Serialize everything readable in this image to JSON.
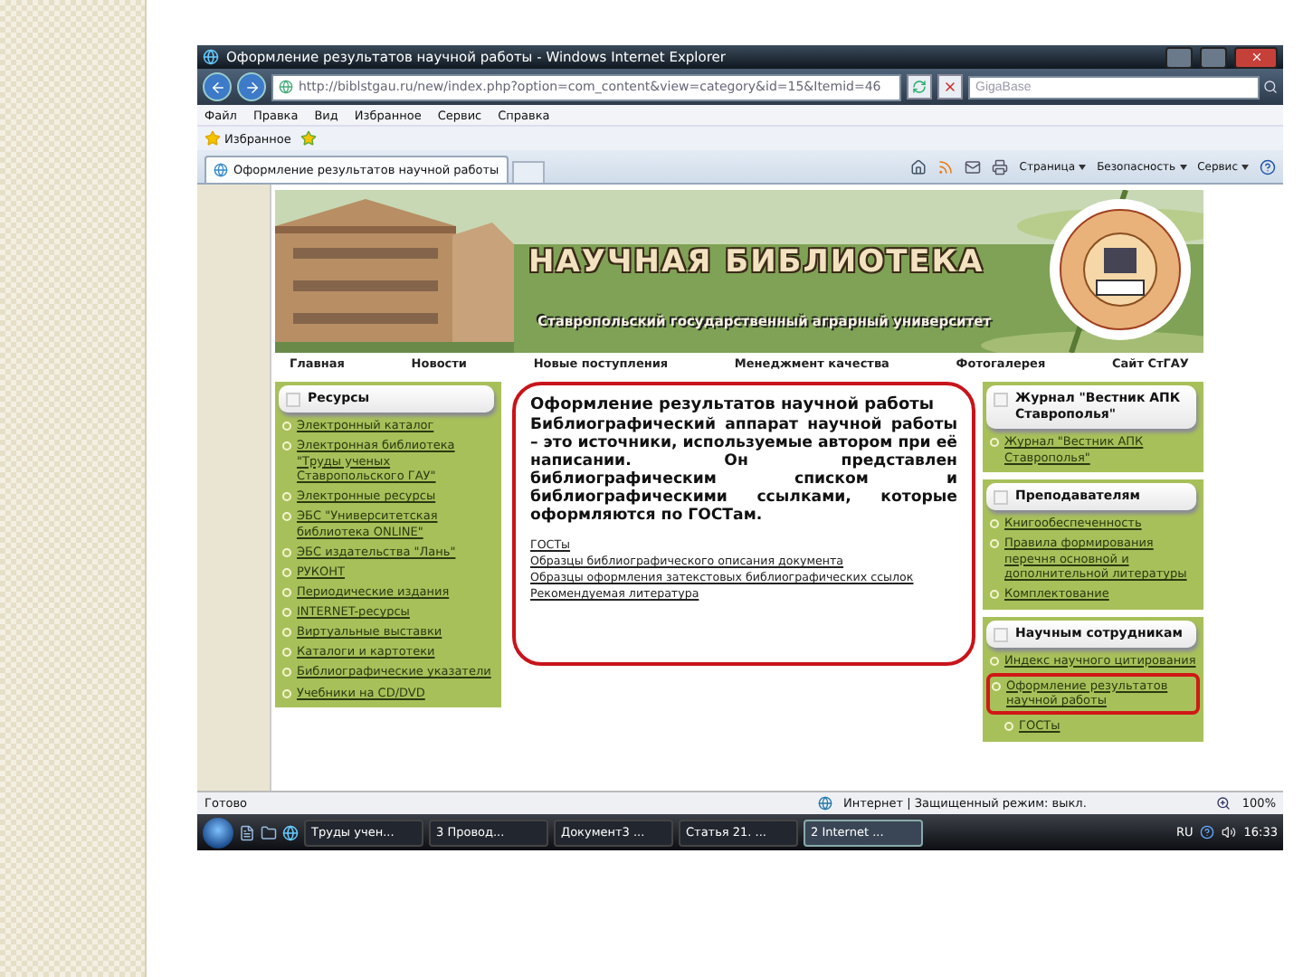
{
  "window": {
    "title": "Оформление результатов научной работы - Windows Internet Explorer"
  },
  "address_bar": {
    "url": "http://biblstgau.ru/new/index.php?option=com_content&view=category&id=15&Itemid=46"
  },
  "search": {
    "placeholder": "GigaBase"
  },
  "menu": [
    "Файл",
    "Правка",
    "Вид",
    "Избранное",
    "Сервис",
    "Справка"
  ],
  "favorites": {
    "label": "Избранное"
  },
  "tabs": [
    {
      "label": "Оформление результатов научной работы",
      "selected": true
    }
  ],
  "command_bar": [
    "Страница",
    "Безопасность",
    "Сервис"
  ],
  "site": {
    "title": "НАУЧНАЯ БИБЛИОТЕКА",
    "subtitle": "Ставропольский государственный аграрный университет",
    "nav": [
      "Главная",
      "Новости",
      "Новые поступления",
      "Менеджмент качества",
      "Фотогалерея",
      "Сайт СтГАУ"
    ],
    "left_panel": {
      "title": "Ресурсы",
      "items": [
        "Электронный каталог",
        "Электронная библиотека \"Труды ученых Ставропольского ГАУ\"",
        "Электронные ресурсы",
        "ЭБС \"Университетская библиотека ONLINE\"",
        "ЭБС издательства \"Лань\"",
        "РУКОНТ",
        "Периодические издания",
        "INTERNET-ресурсы",
        "Виртуальные выставки",
        "Каталоги и картотеки",
        "Библиографические указатели",
        "Учебники на CD/DVD"
      ]
    },
    "article": {
      "highlighted": true,
      "title": "Оформление результатов научной работы",
      "body": "Библиографический аппарат научной работы – это источники, используемые автором при её написании. Он представлен библиографическим списком и библиографическими ссылками, которые оформляются по ГОСТам.",
      "links": [
        "ГОСТы",
        "Образцы библиографического описания документа",
        "Образцы оформления затекстовых библиографических ссылок",
        "Рекомендуемая литература"
      ]
    },
    "right_panels": [
      {
        "title": "Журнал \"Вестник АПК Ставрополья\"",
        "items": [
          {
            "label": "Журнал \"Вестник АПК Ставрополья\"",
            "highlighted": false
          }
        ]
      },
      {
        "title": "Преподавателям",
        "items": [
          {
            "label": "Книгообеспеченность",
            "highlighted": false
          },
          {
            "label": "Правила формирования перечня основной и дополнительной литературы",
            "highlighted": false
          },
          {
            "label": "Комплектование",
            "highlighted": false
          }
        ]
      },
      {
        "title": "Научным сотрудникам",
        "items": [
          {
            "label": "Индекс научного цитирования",
            "highlighted": false
          },
          {
            "label": "Оформление результатов научной работы",
            "highlighted": true,
            "children": [
              {
                "label": "ГОСТы",
                "highlighted": false
              }
            ]
          }
        ]
      }
    ]
  },
  "status_bar": {
    "status": "Готово",
    "zone": "Интернет | Защищенный режим: выкл.",
    "zoom": "100%"
  },
  "taskbar": {
    "tasks": [
      {
        "label": "Труды учен...",
        "selected": false
      },
      {
        "label": "3 Провод...",
        "selected": false
      },
      {
        "label": "Документ3 ...",
        "selected": false
      },
      {
        "label": "Статья 21. ...",
        "selected": false
      },
      {
        "label": "2 Internet ...",
        "selected": true
      }
    ],
    "language": "RU",
    "clock": "16:33"
  }
}
